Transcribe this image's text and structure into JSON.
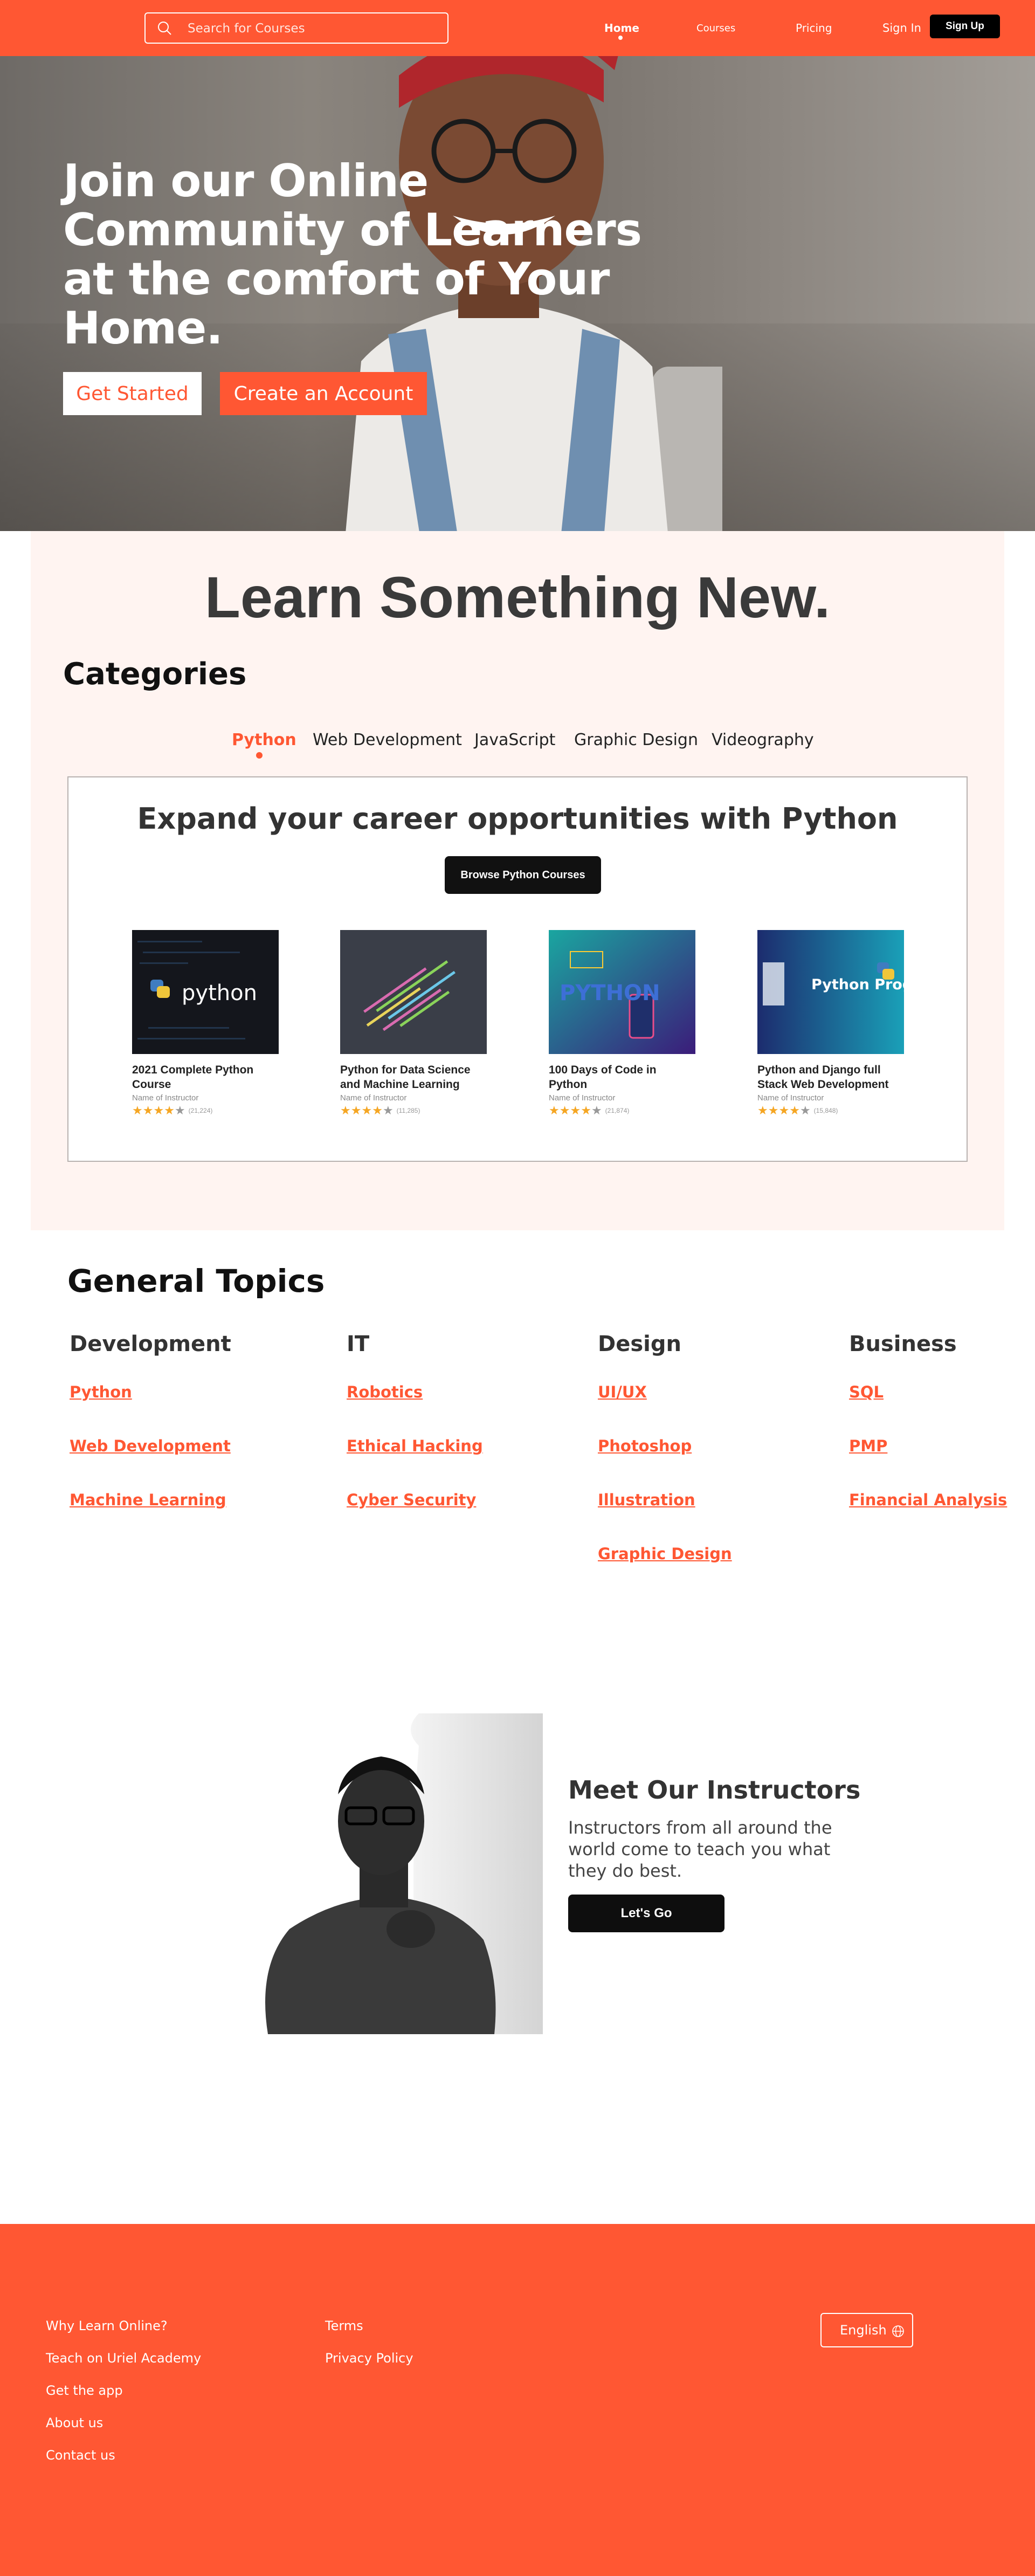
{
  "nav": {
    "search_placeholder": "Search for  Courses",
    "home": "Home",
    "courses": "Courses",
    "pricing": "Pricing",
    "signin": "Sign In",
    "signup": "Sign Up"
  },
  "hero": {
    "title": "Join our Online Community of Learners at the comfort of Your Home.",
    "get_started": "Get Started",
    "create_account": "Create an Account"
  },
  "learn": {
    "title": "Learn Something New.",
    "categories_title": "Categories",
    "tabs": [
      "Python",
      "Web Development",
      "JavaScript",
      "Graphic Design",
      "Videography"
    ],
    "active_tab": "Python",
    "box_title": "Expand your career opportunities with Python",
    "browse_button": "Browse Python Courses",
    "courses": [
      {
        "title": "2021 Complete Python Course",
        "instructor": "Name of Instructor",
        "rating": 4,
        "count": "(21,224)",
        "thumb_text": "python"
      },
      {
        "title": "Python for Data Science and Machine Learning",
        "instructor": "Name of Instructor",
        "rating": 4,
        "count": "(11,285)",
        "thumb_text": ""
      },
      {
        "title": "100 Days of Code in Python",
        "instructor": "Name of Instructor",
        "rating": 4,
        "count": "(21,874)",
        "thumb_text": "PYTHON"
      },
      {
        "title": "Python and Django full Stack Web Development",
        "instructor": "Name of Instructor",
        "rating": 4,
        "count": "(15,848)",
        "thumb_text": "Python Programming"
      }
    ]
  },
  "topics": {
    "title": "General Topics",
    "columns": [
      {
        "heading": "Development",
        "items": [
          "Python",
          "Web Development",
          "Machine Learning"
        ]
      },
      {
        "heading": "IT",
        "items": [
          "Robotics",
          "Ethical Hacking",
          "Cyber Security"
        ]
      },
      {
        "heading": "Design",
        "items": [
          "UI/UX",
          "Photoshop",
          "Illustration",
          "Graphic Design"
        ]
      },
      {
        "heading": "Business",
        "items": [
          "SQL",
          "PMP",
          "Financial Analysis"
        ]
      }
    ]
  },
  "instructors": {
    "title": "Meet Our Instructors",
    "text": "Instructors from all around the world come to teach you what they do best.",
    "button": "Let's Go"
  },
  "footer": {
    "col1": [
      "Why Learn Online?",
      "Teach on Uriel Academy",
      "Get the app",
      "About us",
      "Contact us"
    ],
    "col2": [
      "Terms",
      "Privacy Policy"
    ],
    "language": "English"
  },
  "colors": {
    "accent": "#ff5733",
    "dark": "#111111",
    "section_bg": "#fff4f1",
    "star": "#f5a623"
  }
}
